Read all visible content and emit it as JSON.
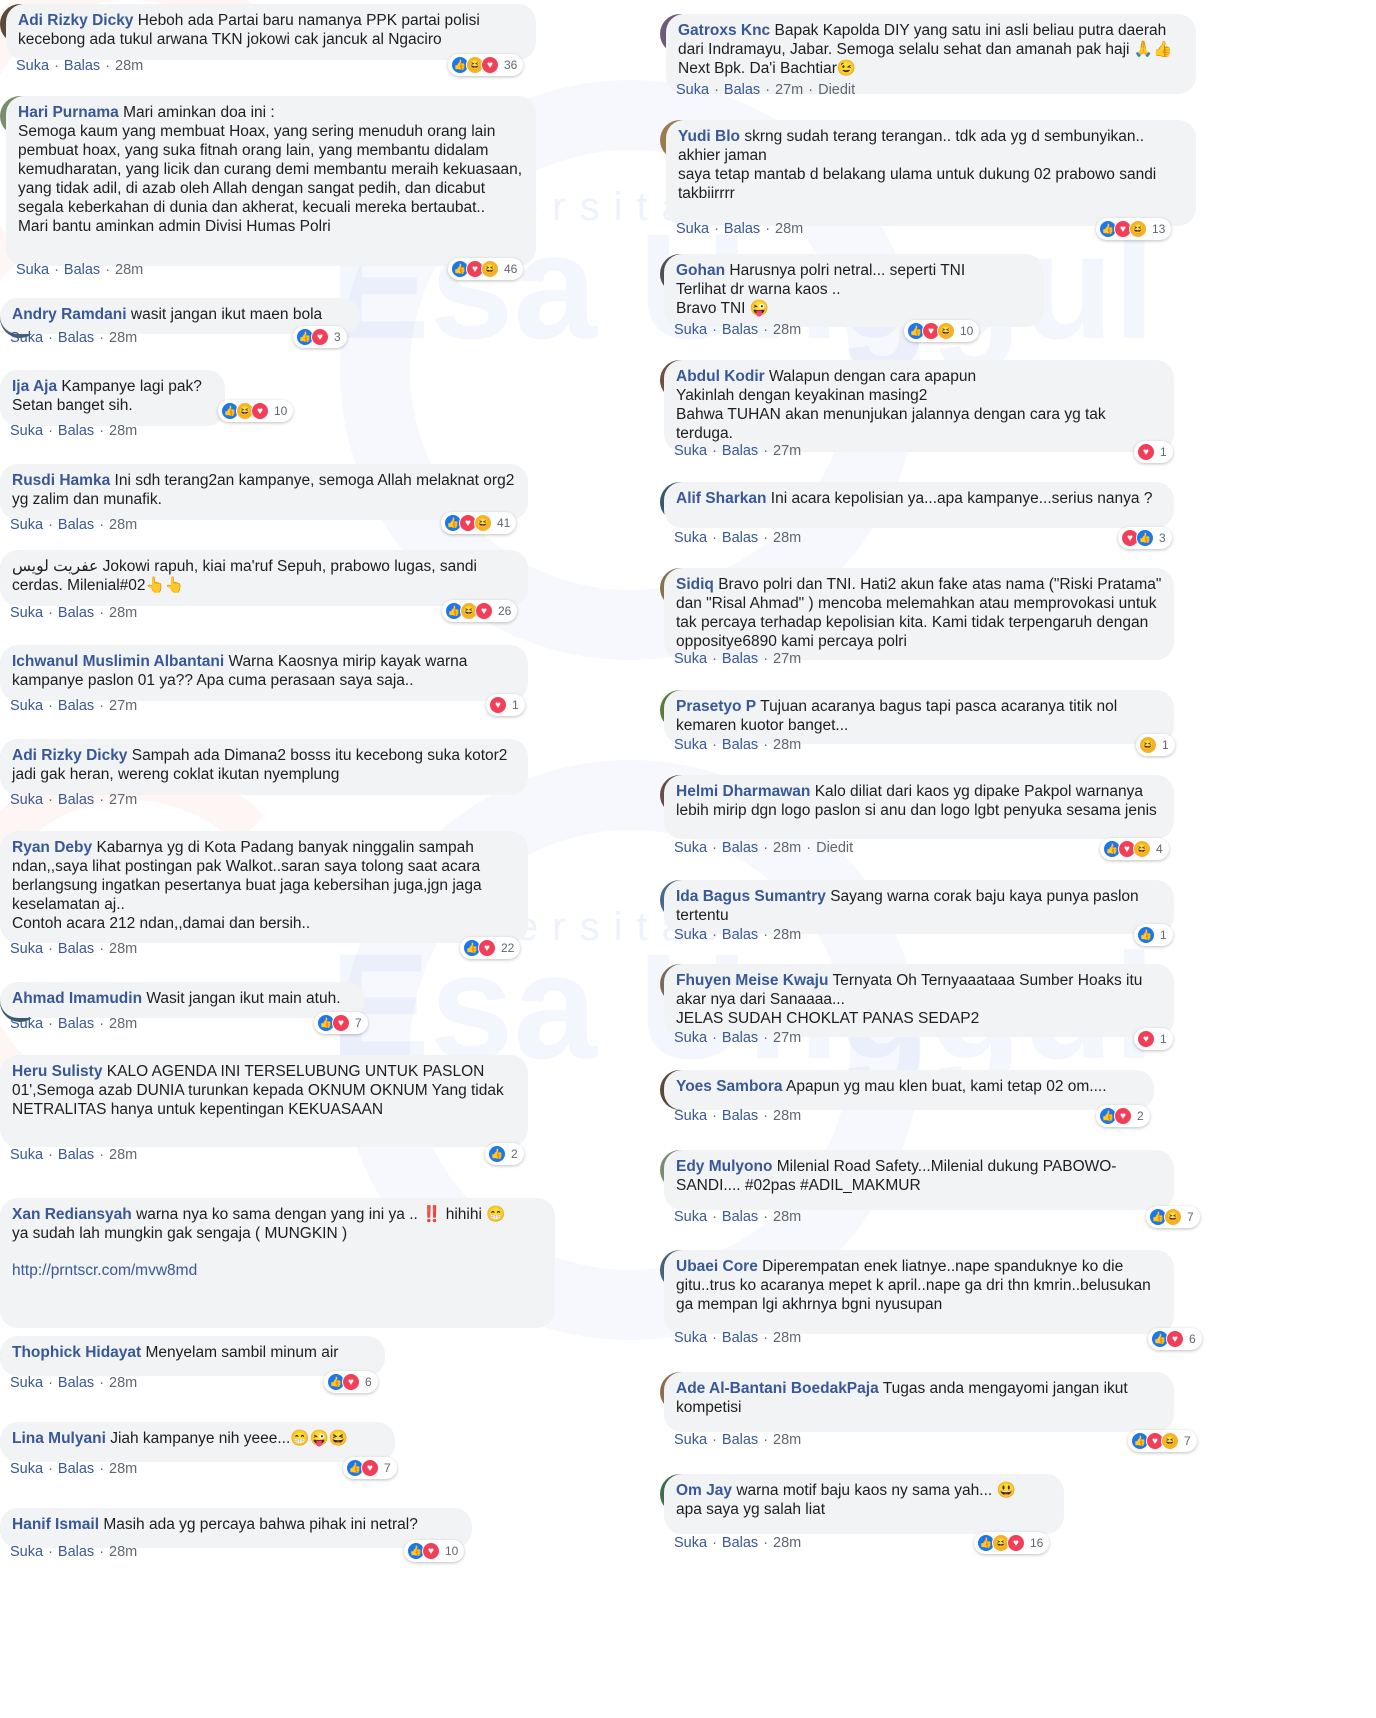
{
  "reactions_legend": {
    "like": "like-icon",
    "love": "love-icon",
    "haha": "haha-icon"
  },
  "colors": {
    "author": "#385898",
    "bubble": "#f2f3f5",
    "like": "#1877f2",
    "love": "#f33e58",
    "haha": "#f7b125"
  },
  "watermark": {
    "brand": "Esa Unggul",
    "sub": "Universitas"
  },
  "left_comments": [
    {
      "author": "Adi Rizky Dicky",
      "text": "Heboh ada Partai baru namanya PPK partai polisi kecebong ada tukul arwana TKN jokowi cak jancuk al Ngaciro",
      "like": "Suka",
      "reply": "Balas",
      "time": "28m",
      "edited": "",
      "link": "",
      "reactions": [
        "like",
        "haha",
        "love"
      ],
      "count": "36"
    },
    {
      "author": "Hari Purnama",
      "text": "Mari aminkan doa ini :\nSemoga kaum yang membuat Hoax, yang sering menuduh orang lain pembuat hoax, yang suka fitnah orang lain, yang membantu didalam kemudharatan, yang licik dan curang demi membantu meraih kekuasaan, yang tidak adil, di azab oleh Allah dengan sangat pedih, dan dicabut segala keberkahan di dunia dan akherat, kecuali mereka bertaubat..\nMari bantu aminkan admin Divisi Humas Polri",
      "like": "Suka",
      "reply": "Balas",
      "time": "28m",
      "edited": "",
      "link": "",
      "reactions": [
        "like",
        "love",
        "haha"
      ],
      "count": "46"
    },
    {
      "author": "Andry Ramdani",
      "text": "wasit jangan ikut maen bola",
      "like": "Suka",
      "reply": "Balas",
      "time": "28m",
      "edited": "",
      "link": "",
      "reactions": [
        "like",
        "love"
      ],
      "count": "3"
    },
    {
      "author": "Ija Aja",
      "text": "Kampanye lagi pak?\nSetan banget sih.",
      "like": "Suka",
      "reply": "Balas",
      "time": "28m",
      "edited": "",
      "link": "",
      "reactions": [
        "like",
        "haha",
        "love"
      ],
      "count": "10"
    },
    {
      "author": "Rusdi Hamka",
      "text": "Ini sdh terang2an kampanye, semoga Allah melaknat org2 yg zalim dan munafik.",
      "like": "Suka",
      "reply": "Balas",
      "time": "28m",
      "edited": "",
      "link": "",
      "reactions": [
        "like",
        "love",
        "haha"
      ],
      "count": "41"
    },
    {
      "author": "",
      "text": "عفريت لويس Jokowi rapuh, kiai ma'ruf Sepuh, prabowo lugas, sandi cerdas. Milenial#02👆👆",
      "like": "Suka",
      "reply": "Balas",
      "time": "28m",
      "edited": "",
      "link": "",
      "reactions": [
        "like",
        "haha",
        "love"
      ],
      "count": "26"
    },
    {
      "author": "Ichwanul Muslimin Albantani",
      "text": "Warna Kaosnya mirip kayak warna kampanye paslon 01 ya?? Apa cuma perasaan saya saja..",
      "like": "Suka",
      "reply": "Balas",
      "time": "27m",
      "edited": "",
      "link": "",
      "reactions": [
        "love"
      ],
      "count": "1"
    },
    {
      "author": "Adi Rizky Dicky",
      "text": "Sampah ada Dimana2 bosss itu kecebong suka kotor2 jadi gak heran, wereng coklat ikutan nyemplung",
      "like": "Suka",
      "reply": "Balas",
      "time": "27m",
      "edited": "",
      "link": "",
      "reactions": [],
      "count": ""
    },
    {
      "author": "Ryan Deby",
      "text": "Kabarnya yg di Kota Padang banyak ninggalin sampah ndan,,saya lihat postingan pak Walkot..saran saya tolong saat acara berlangsung ingatkan pesertanya buat jaga kebersihan juga,jgn jaga keselamatan aj..\nContoh acara 212 ndan,,damai dan bersih..",
      "like": "Suka",
      "reply": "Balas",
      "time": "28m",
      "edited": "",
      "link": "",
      "reactions": [
        "like",
        "love"
      ],
      "count": "22"
    },
    {
      "author": "Ahmad Imamudin",
      "text": "Wasit jangan ikut main atuh.",
      "like": "Suka",
      "reply": "Balas",
      "time": "28m",
      "edited": "",
      "link": "",
      "reactions": [
        "like",
        "love"
      ],
      "count": "7"
    },
    {
      "author": "Heru Sulisty",
      "text": "KALO AGENDA INI TERSELUBUNG UNTUK PASLON 01',Semoga azab DUNIA turunkan kepada OKNUM OKNUM Yang tidak NETRALITAS hanya untuk kepentingan KEKUASAAN",
      "like": "Suka",
      "reply": "Balas",
      "time": "28m",
      "edited": "",
      "link": "",
      "reactions": [
        "like"
      ],
      "count": "2"
    },
    {
      "author": "Xan Rediansyah",
      "text": "warna nya ko sama dengan yang ini ya .. ‼️ hihihi 😁\nya sudah lah mungkin gak sengaja ( MUNGKIN )",
      "like": "",
      "reply": "",
      "time": "",
      "edited": "",
      "link": "http://prntscr.com/mvw8md",
      "reactions": [],
      "count": ""
    },
    {
      "author": "Thophick Hidayat",
      "text": "Menyelam sambil minum air",
      "like": "Suka",
      "reply": "Balas",
      "time": "28m",
      "edited": "",
      "link": "",
      "reactions": [
        "like",
        "love"
      ],
      "count": "6"
    },
    {
      "author": "Lina Mulyani",
      "text": "Jiah kampanye nih yeee...😁😜😆",
      "like": "Suka",
      "reply": "Balas",
      "time": "28m",
      "edited": "",
      "link": "",
      "reactions": [
        "like",
        "love"
      ],
      "count": "7"
    },
    {
      "author": "Hanif Ismail",
      "text": "Masih ada yg percaya bahwa pihak ini netral?",
      "like": "Suka",
      "reply": "Balas",
      "time": "28m",
      "edited": "",
      "link": "",
      "reactions": [
        "like",
        "love"
      ],
      "count": "10"
    }
  ],
  "right_comments": [
    {
      "author": "Gatroxs Knc",
      "text": "Bapak Kapolda DIY yang satu ini asli beliau putra daerah dari Indramayu, Jabar. Semoga selalu sehat dan amanah pak haji 🙏👍 Next Bpk. Da'i Bachtiar😉",
      "like": "Suka",
      "reply": "Balas",
      "time": "27m",
      "edited": "Diedit",
      "link": "",
      "reactions": [],
      "count": ""
    },
    {
      "author": "Yudi Blo",
      "text": "skrng sudah terang terangan.. tdk ada yg d sembunyikan.. akhier jaman\nsaya tetap mantab d belakang ulama untuk dukung 02 prabowo sandi\ntakbiirrrr",
      "like": "Suka",
      "reply": "Balas",
      "time": "28m",
      "edited": "",
      "link": "",
      "reactions": [
        "like",
        "love",
        "haha"
      ],
      "count": "13"
    },
    {
      "author": "Gohan",
      "text": "Harusnya polri netral... seperti TNI\nTerlihat dr warna kaos ..\nBravo TNI 😜",
      "like": "Suka",
      "reply": "Balas",
      "time": "28m",
      "edited": "",
      "link": "",
      "reactions": [
        "like",
        "love",
        "haha"
      ],
      "count": "10"
    },
    {
      "author": "Abdul Kodir",
      "text": "Walapun dengan cara apapun\nYakinlah dengan keyakinan masing2\nBahwa TUHAN akan menunjukan jalannya dengan cara yg tak terduga.",
      "like": "Suka",
      "reply": "Balas",
      "time": "27m",
      "edited": "",
      "link": "",
      "reactions": [
        "love"
      ],
      "count": "1"
    },
    {
      "author": "Alif Sharkan",
      "text": "Ini acara kepolisian ya...apa kampanye...serius nanya ?",
      "like": "Suka",
      "reply": "Balas",
      "time": "28m",
      "edited": "",
      "link": "",
      "reactions": [
        "love",
        "like"
      ],
      "count": "3"
    },
    {
      "author": "Sidiq",
      "text": "Bravo polri dan TNI. Hati2 akun fake atas nama (\"Riski Pratama\" dan \"Risal Ahmad\" ) mencoba melemahkan atau memprovokasi untuk tak percaya terhadap kepolisian kita. Kami tidak terpengaruh dengan oppositye6890 kami percaya polri",
      "like": "Suka",
      "reply": "Balas",
      "time": "27m",
      "edited": "",
      "link": "",
      "reactions": [],
      "count": ""
    },
    {
      "author": "Prasetyo P",
      "text": "Tujuan acaranya bagus tapi pasca acaranya titik nol kemaren kuotor banget...",
      "like": "Suka",
      "reply": "Balas",
      "time": "28m",
      "edited": "",
      "link": "",
      "reactions": [
        "haha"
      ],
      "count": "1"
    },
    {
      "author": "Helmi Dharmawan",
      "text": "Kalo diliat dari kaos yg dipake Pakpol warnanya lebih mirip dgn logo paslon si anu dan logo lgbt penyuka sesama jenis",
      "like": "Suka",
      "reply": "Balas",
      "time": "28m",
      "edited": "Diedit",
      "link": "",
      "reactions": [
        "like",
        "love",
        "haha"
      ],
      "count": "4"
    },
    {
      "author": "Ida Bagus Sumantry",
      "text": "Sayang warna corak baju kaya punya paslon tertentu",
      "like": "Suka",
      "reply": "Balas",
      "time": "28m",
      "edited": "",
      "link": "",
      "reactions": [
        "like"
      ],
      "count": "1"
    },
    {
      "author": "Fhuyen Meise Kwaju",
      "text": "Ternyata Oh Ternyaaataaa Sumber Hoaks itu akar nya dari Sanaaaa...\nJELAS SUDAH CHOKLAT PANAS SEDAP2",
      "like": "Suka",
      "reply": "Balas",
      "time": "27m",
      "edited": "",
      "link": "",
      "reactions": [
        "love"
      ],
      "count": "1"
    },
    {
      "author": "Yoes Sambora",
      "text": "Apapun yg mau klen buat, kami tetap 02 om....",
      "like": "Suka",
      "reply": "Balas",
      "time": "28m",
      "edited": "",
      "link": "",
      "reactions": [
        "like",
        "love"
      ],
      "count": "2"
    },
    {
      "author": "Edy Mulyono",
      "text": "Milenial Road Safety...Milenial dukung PABOWO-SANDI.... #02pas #ADIL_MAKMUR",
      "like": "Suka",
      "reply": "Balas",
      "time": "28m",
      "edited": "",
      "link": "",
      "reactions": [
        "like",
        "haha"
      ],
      "count": "7"
    },
    {
      "author": "Ubaei Core",
      "text": "Diperempatan enek liatnye..nape spanduknye ko die gitu..trus ko acaranya mepet k april..nape ga dri thn kmrin..belusukan ga mempan lgi akhrnya bgni nyusupan",
      "like": "Suka",
      "reply": "Balas",
      "time": "28m",
      "edited": "",
      "link": "",
      "reactions": [
        "like",
        "love"
      ],
      "count": "6"
    },
    {
      "author": "Ade Al-Bantani BoedakPaja",
      "text": "Tugas anda mengayomi jangan ikut kompetisi",
      "like": "Suka",
      "reply": "Balas",
      "time": "28m",
      "edited": "",
      "link": "",
      "reactions": [
        "like",
        "love",
        "haha"
      ],
      "count": "7"
    },
    {
      "author": "Om Jay",
      "text": "warna motif baju kaos ny sama yah... 😃\napa saya yg salah liat",
      "like": "Suka",
      "reply": "Balas",
      "time": "28m",
      "edited": "",
      "link": "",
      "reactions": [
        "like",
        "haha",
        "love"
      ],
      "count": "16"
    }
  ]
}
